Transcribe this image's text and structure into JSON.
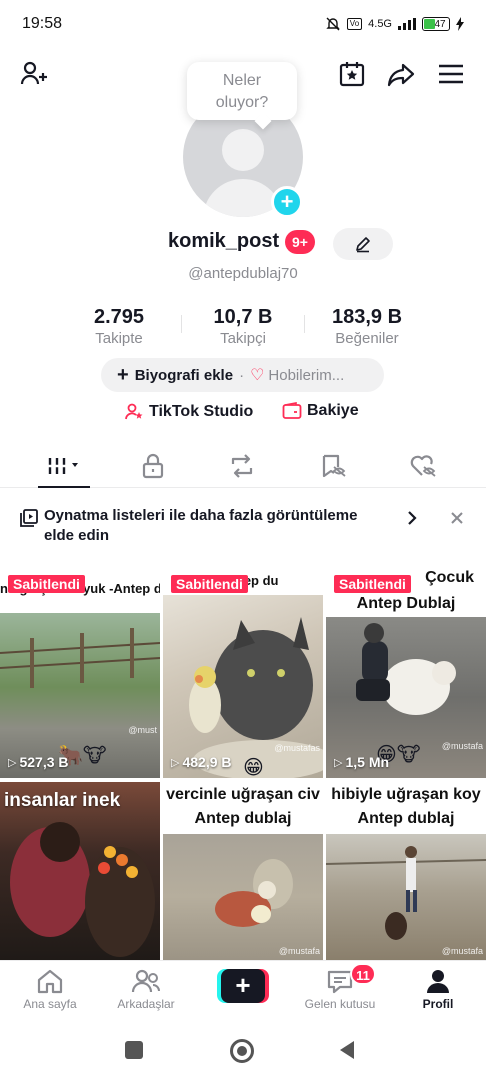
{
  "status_bar": {
    "time": "19:58",
    "network": "4.5G",
    "battery": "47"
  },
  "tooltip": {
    "line1": "Neler",
    "line2": "oluyor?"
  },
  "profile": {
    "username": "komik_post",
    "notification_badge": "9+",
    "handle": "@antepdublaj70"
  },
  "stats": [
    {
      "value": "2.795",
      "label": "Takipte"
    },
    {
      "value": "10,7 B",
      "label": "Takipçi"
    },
    {
      "value": "183,9 B",
      "label": "Beğeniler"
    }
  ],
  "bio": {
    "add_label": "Biyografi ekle",
    "separator": "·",
    "hobby_label": "Hobilerim..."
  },
  "studio": {
    "studio_label": "TikTok Studio",
    "balance_label": "Bakiye"
  },
  "playlist_banner": {
    "text": "Oynatma listeleri ile daha fazla görüntüleme elde edin"
  },
  "videos": [
    {
      "caption": "n uğraşan Koyuk -Antep du",
      "pinned": "Sabitlendi",
      "views": "527,3 B",
      "watermark": "@must",
      "emoji": "🐂🐮"
    },
    {
      "caption": "di Antep du",
      "pinned": "Sabitlendi",
      "views": "482,9 B",
      "watermark": "@mustafas",
      "emoji": "😁"
    },
    {
      "caption": "Çocuk",
      "caption2": "Antep Dublaj",
      "pinned": "Sabitlendi",
      "views": "1,5 Mn",
      "watermark": "@mustafa",
      "emoji": "😁🐮"
    },
    {
      "caption": "insanlar inek",
      "pinned": "",
      "views": "",
      "watermark": "",
      "emoji": ""
    },
    {
      "caption": "vercinle uğraşan civ",
      "caption2": "Antep dublaj",
      "pinned": "",
      "views": "",
      "watermark": "@mustafa",
      "emoji": ""
    },
    {
      "caption": "hibiyle uğraşan koy",
      "caption2": "Antep dublaj",
      "pinned": "",
      "views": "",
      "watermark": "@mustafa",
      "emoji": ""
    }
  ],
  "bottom_nav": {
    "home": "Ana sayfa",
    "friends": "Arkadaşlar",
    "create": "+",
    "inbox": "Gelen kutusu",
    "inbox_badge": "11",
    "profile": "Profil"
  },
  "colors": {
    "accent_red": "#fe2c55",
    "accent_cyan": "#25f4ee",
    "text_primary": "#161823",
    "text_secondary": "#8a8b91"
  }
}
